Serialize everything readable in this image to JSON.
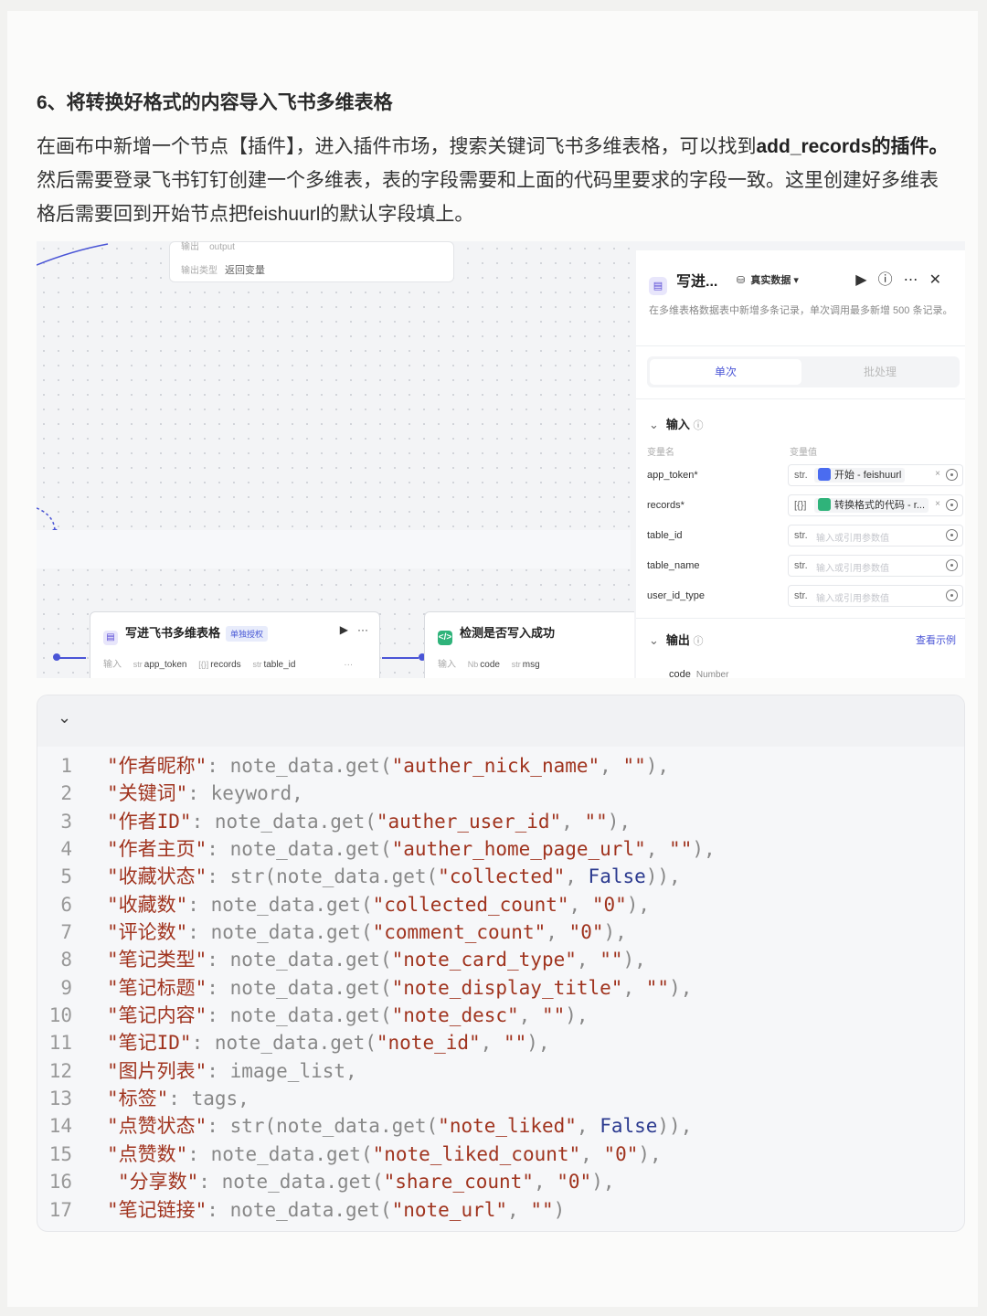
{
  "article": {
    "heading": "6、将转换好格式的内容导入飞书多维表格",
    "para_a": "在画布中新增一个节点【插件】，进入插件市场，搜索关键词飞书多维表格，可以找到",
    "para_b": "add_records的插件。",
    "para_c": "然后需要登录飞书钉钉创建一个多维表，表的字段需要和上面的代码里要求的字段一致。这里创建好多维表格后需要回到开始节点把feishuurl的默认字段填上。"
  },
  "canvas": {
    "top_node": {
      "row1_label": "输出",
      "row1_value": "output",
      "row2_label": "输出类型",
      "row2_value": "返回变量"
    },
    "node_write": {
      "title": "写进飞书多维表格",
      "badge": "单独授权",
      "input_label": "输入",
      "fields": [
        {
          "type": "str",
          "name": "app_token"
        },
        {
          "type": "[{}]",
          "name": "records"
        },
        {
          "type": "str",
          "name": "table_id"
        }
      ],
      "more": "···"
    },
    "node_check": {
      "title": "检测是否写入成功",
      "input_label": "输入",
      "fields": [
        {
          "type": "Nb",
          "name": "code"
        },
        {
          "type": "str",
          "name": "msg"
        }
      ]
    }
  },
  "panel": {
    "title": "写进...",
    "data_toggle": "真实数据",
    "description": "在多维表格数据表中新增多条记录，单次调用最多新增 500 条记录。",
    "tabs": {
      "single": "单次",
      "batch": "批处理"
    },
    "input_section": "输入",
    "col_name": "变量名",
    "col_value": "变量值",
    "rows": [
      {
        "name": "app_token*",
        "type": "str.",
        "value": "开始 - feishuurl",
        "kind": "tag",
        "color": "#4a6cf0"
      },
      {
        "name": "records*",
        "type": "[{}]",
        "value": "转换格式的代码 - r...",
        "kind": "tag",
        "color": "#2fb37a"
      },
      {
        "name": "table_id",
        "type": "str.",
        "value": "输入或引用参数值",
        "kind": "placeholder"
      },
      {
        "name": "table_name",
        "type": "str.",
        "value": "输入或引用参数值",
        "kind": "placeholder"
      },
      {
        "name": "user_id_type",
        "type": "str.",
        "value": "输入或引用参数值",
        "kind": "placeholder"
      }
    ],
    "output_section": "输出",
    "view_example": "查看示例",
    "output_row": {
      "name": "code",
      "type": "Number"
    }
  },
  "code": {
    "lines": [
      {
        "n": "1",
        "html": "<span class=\"s\">\"作者昵称\"</span>: note_data.get(<span class=\"s\">\"auther_nick_name\"</span>, <span class=\"s\">\"\"</span>),"
      },
      {
        "n": "2",
        "html": "<span class=\"s\">\"关键词\"</span>: keyword,"
      },
      {
        "n": "3",
        "html": "<span class=\"s\">\"作者ID\"</span>: note_data.get(<span class=\"s\">\"auther_user_id\"</span>, <span class=\"s\">\"\"</span>),"
      },
      {
        "n": "4",
        "html": "<span class=\"s\">\"作者主页\"</span>: note_data.get(<span class=\"s\">\"auther_home_page_url\"</span>, <span class=\"s\">\"\"</span>),"
      },
      {
        "n": "5",
        "html": "<span class=\"s\">\"收藏状态\"</span>: str(note_data.get(<span class=\"s\">\"collected\"</span>, <span class=\"kw\">False</span>)),"
      },
      {
        "n": "6",
        "html": "<span class=\"s\">\"收藏数\"</span>: note_data.get(<span class=\"s\">\"collected_count\"</span>, <span class=\"s\">\"0\"</span>),"
      },
      {
        "n": "7",
        "html": "<span class=\"s\">\"评论数\"</span>: note_data.get(<span class=\"s\">\"comment_count\"</span>, <span class=\"s\">\"0\"</span>),"
      },
      {
        "n": "8",
        "html": "<span class=\"s\">\"笔记类型\"</span>: note_data.get(<span class=\"s\">\"note_card_type\"</span>, <span class=\"s\">\"\"</span>),"
      },
      {
        "n": "9",
        "html": "<span class=\"s\">\"笔记标题\"</span>: note_data.get(<span class=\"s\">\"note_display_title\"</span>, <span class=\"s\">\"\"</span>),"
      },
      {
        "n": "10",
        "html": "<span class=\"s\">\"笔记内容\"</span>: note_data.get(<span class=\"s\">\"note_desc\"</span>, <span class=\"s\">\"\"</span>),"
      },
      {
        "n": "11",
        "html": "<span class=\"s\">\"笔记ID\"</span>: note_data.get(<span class=\"s\">\"note_id\"</span>, <span class=\"s\">\"\"</span>),"
      },
      {
        "n": "12",
        "html": "<span class=\"s\">\"图片列表\"</span>: image_list,"
      },
      {
        "n": "13",
        "html": "<span class=\"s\">\"标签\"</span>: tags,"
      },
      {
        "n": "14",
        "html": "<span class=\"s\">\"点赞状态\"</span>: str(note_data.get(<span class=\"s\">\"note_liked\"</span>, <span class=\"kw\">False</span>)),"
      },
      {
        "n": "15",
        "html": "<span class=\"s\">\"点赞数\"</span>: note_data.get(<span class=\"s\">\"note_liked_count\"</span>, <span class=\"s\">\"0\"</span>),"
      },
      {
        "n": "16",
        "html": "<span class=\"s\">\"分享数\"</span>: note_data.get(<span class=\"s\">\"share_count\"</span>, <span class=\"s\">\"0\"</span>),",
        "indent": true
      },
      {
        "n": "17",
        "html": "<span class=\"s\">\"笔记链接\"</span>: note_data.get(<span class=\"s\">\"note_url\"</span>, <span class=\"s\">\"\"</span>)"
      }
    ]
  }
}
